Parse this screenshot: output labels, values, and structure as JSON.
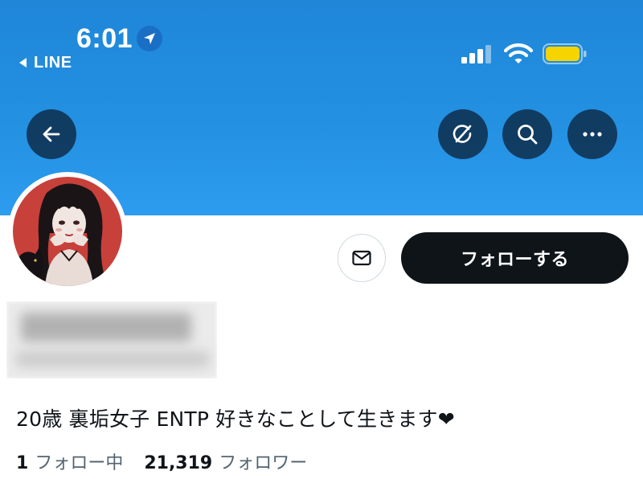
{
  "status_bar": {
    "time": "6:01",
    "back_app_label": "LINE",
    "location_icon": "location-arrow-icon",
    "signal_icon": "cellular-signal-icon",
    "wifi_icon": "wifi-icon",
    "battery_icon": "battery-icon",
    "battery_color": "#f5d400"
  },
  "header": {
    "back_icon": "arrow-left-icon",
    "grok_icon": "grok-icon",
    "search_icon": "search-icon",
    "more_icon": "more-dots-icon",
    "banner_color": "#2390e1"
  },
  "profile": {
    "dm_icon": "envelope-icon",
    "follow_label": "フォローする",
    "bio": "20歳 裏垢女子 ENTP 好きなことして生きます❤",
    "following_count": "1",
    "following_label": "フォロー中",
    "followers_count": "21,319",
    "followers_label": "フォロワー"
  },
  "colors": {
    "text_primary": "#0f1419",
    "text_secondary": "#536471",
    "button_dark": "#0f1419"
  }
}
